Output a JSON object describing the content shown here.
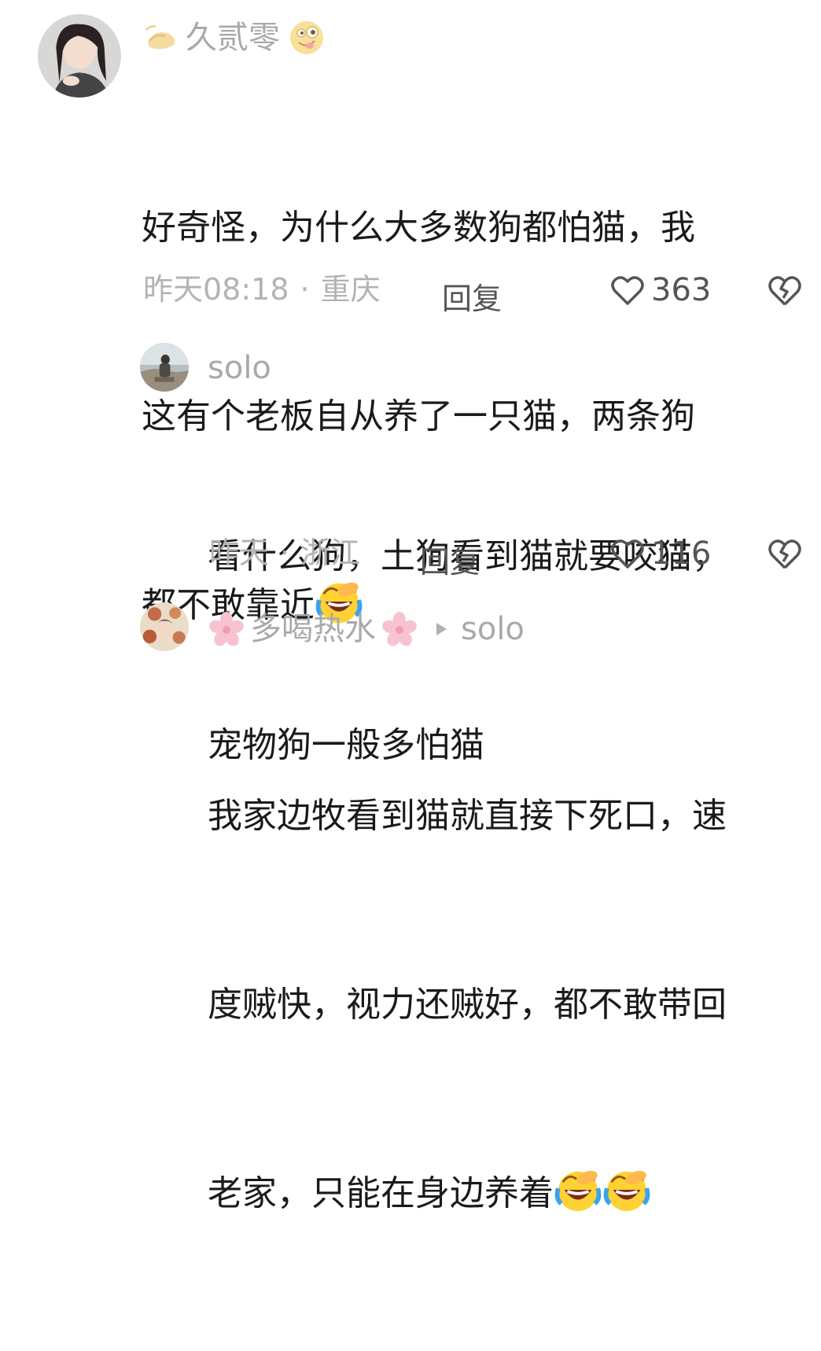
{
  "comments": [
    {
      "username": "久贰零",
      "lines": [
        "好奇怪，为什么大多数狗都怕猫，我",
        "这有个老板自从养了一只猫，两条狗",
        "都不敢靠近"
      ],
      "time": "昨天08:18",
      "location": "重庆",
      "reply_label": "回复",
      "likes": "363"
    },
    {
      "username": "solo",
      "lines": [
        "看什么狗，土狗看到猫就要咬猫，",
        "宠物狗一般多怕猫"
      ],
      "time": "昨天",
      "location": "浙江",
      "reply_label": "回复",
      "likes": "116"
    },
    {
      "username": "多喝热水",
      "reply_to": "solo",
      "lines": [
        "我家边牧看到猫就直接下死口，速",
        "度贼快，视力还贼好，都不敢带回",
        "老家，只能在身边养着"
      ]
    }
  ],
  "separator": "·",
  "icons": {
    "emoji_inline": "laughing-crying-emoji",
    "heart": "heart-outline-icon",
    "dislike": "broken-heart-icon",
    "arrow": "reply-arrow-icon"
  }
}
